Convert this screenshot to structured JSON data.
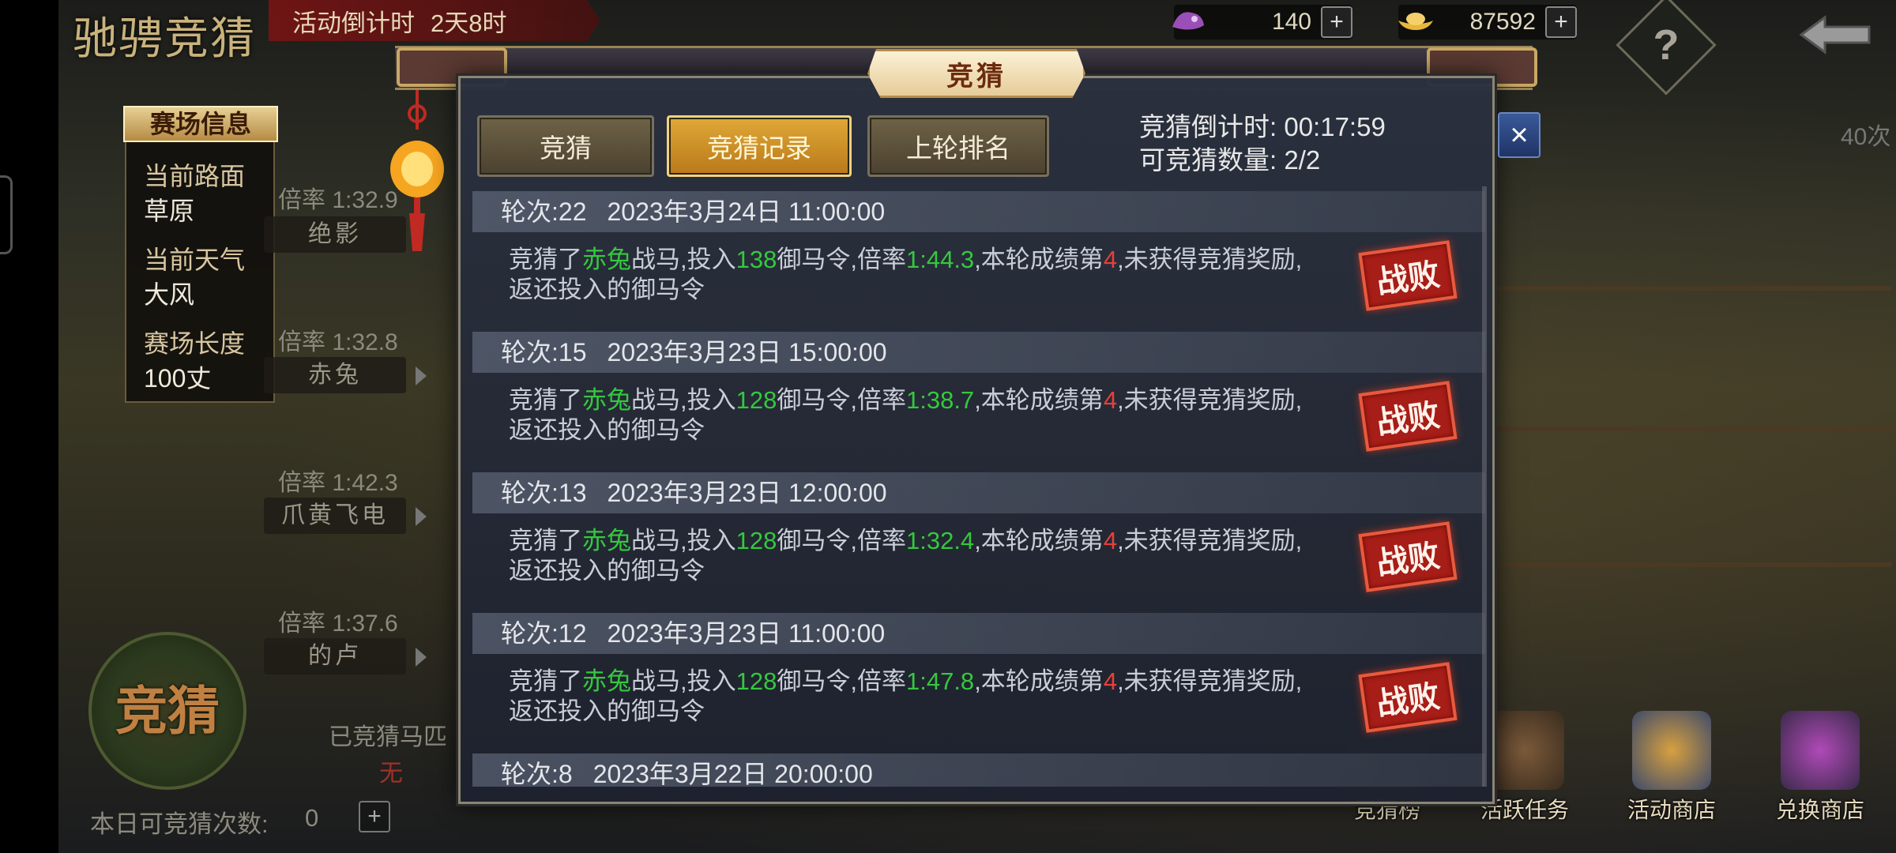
{
  "top": {
    "game_title": "驰骋竞猜",
    "event_countdown_label": "活动倒计时",
    "event_countdown_value": "2天8时",
    "resource1": "140",
    "resource2": "87592",
    "help_label": "?"
  },
  "info_panel": {
    "title": "赛场信息",
    "road_label": "当前路面",
    "road_value": "草原",
    "weather_label": "当前天气",
    "weather_value": "大风",
    "length_label": "赛场长度",
    "length_value": "100丈"
  },
  "horses": [
    {
      "odds": "倍率 1:32.9",
      "name": "绝影"
    },
    {
      "odds": "倍率 1:32.8",
      "name": "赤兔"
    },
    {
      "odds": "倍率 1:42.3",
      "name": "爪黄飞电"
    },
    {
      "odds": "倍率 1:37.6",
      "name": "的卢"
    }
  ],
  "bottom_left": {
    "emblem": "竞猜",
    "bet_horse_label": "已竞猜马匹",
    "bet_horse_value": "无",
    "daily_label": "本日可竞猜次数:",
    "daily_value": "0",
    "plus": "+"
  },
  "bottom_right": [
    {
      "label": "竞猜榜"
    },
    {
      "label": "活跃任务"
    },
    {
      "label": "活动商店"
    },
    {
      "label": "兑换商店"
    }
  ],
  "side": {
    "count": "40次",
    "close": "×"
  },
  "modal": {
    "title": "竞猜",
    "tabs": [
      {
        "label": "竞猜"
      },
      {
        "label": "竞猜记录"
      },
      {
        "label": "上轮排名"
      }
    ],
    "countdown_label": "竞猜倒计时:",
    "countdown_value": "00:17:59",
    "quota_label": "可竞猜数量:",
    "quota_value": "2/2",
    "records": [
      {
        "round": "轮次:22",
        "time": "2023年3月24日 11:00:00",
        "t1": "竞猜了",
        "horse": "赤兔",
        "t2": "战马,投入",
        "amount": "138",
        "t3": "御马令,倍率",
        "odds": "1:44.3",
        "t4": ",本轮成绩第",
        "rank": "4",
        "t5": ",未获得竞猜奖励,返还投入的御马令",
        "result": "战败"
      },
      {
        "round": "轮次:15",
        "time": "2023年3月23日 15:00:00",
        "t1": "竞猜了",
        "horse": "赤兔",
        "t2": "战马,投入",
        "amount": "128",
        "t3": "御马令,倍率",
        "odds": "1:38.7",
        "t4": ",本轮成绩第",
        "rank": "4",
        "t5": ",未获得竞猜奖励,返还投入的御马令",
        "result": "战败"
      },
      {
        "round": "轮次:13",
        "time": "2023年3月23日 12:00:00",
        "t1": "竞猜了",
        "horse": "赤兔",
        "t2": "战马,投入",
        "amount": "128",
        "t3": "御马令,倍率",
        "odds": "1:32.4",
        "t4": ",本轮成绩第",
        "rank": "4",
        "t5": ",未获得竞猜奖励,返还投入的御马令",
        "result": "战败"
      },
      {
        "round": "轮次:12",
        "time": "2023年3月23日 11:00:00",
        "t1": "竞猜了",
        "horse": "赤兔",
        "t2": "战马,投入",
        "amount": "128",
        "t3": "御马令,倍率",
        "odds": "1:47.8",
        "t4": ",本轮成绩第",
        "rank": "4",
        "t5": ",未获得竞猜奖励,返还投入的御马令",
        "result": "战败"
      },
      {
        "round": "轮次:8",
        "time": "2023年3月22日 20:00:00"
      }
    ]
  },
  "colors": {
    "accent_green": "#35c83f",
    "accent_red": "#e8403a",
    "tab_active": "#e0a838"
  }
}
